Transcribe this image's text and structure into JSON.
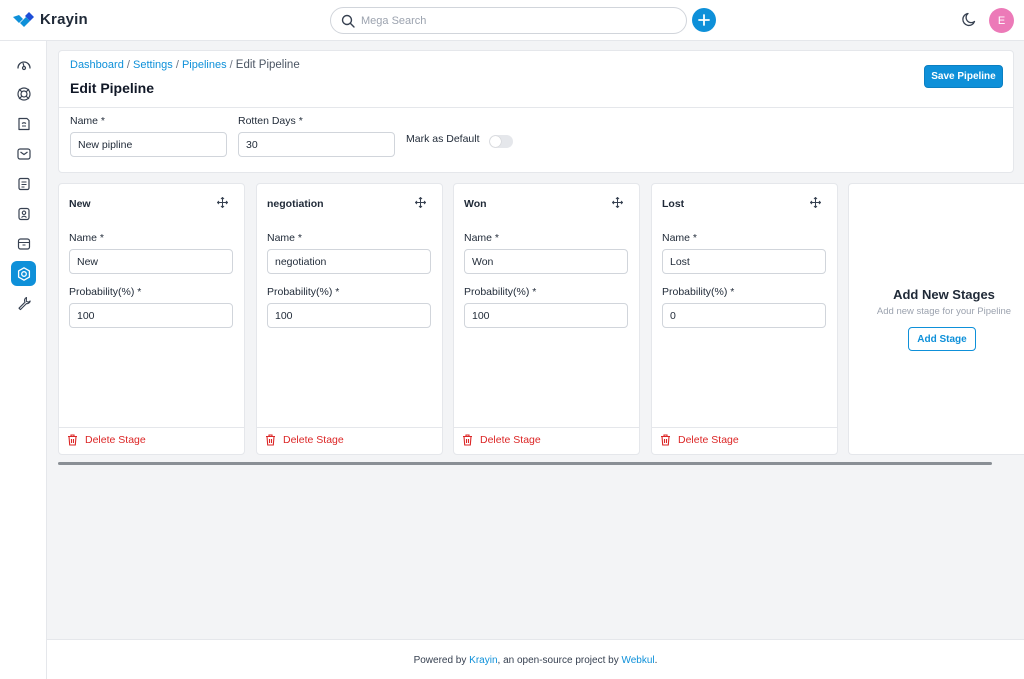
{
  "app": {
    "name": "Krayin"
  },
  "topbar": {
    "search_placeholder": "Mega Search",
    "avatar_initial": "E"
  },
  "breadcrumb": {
    "dashboard": "Dashboard",
    "settings": "Settings",
    "pipelines": "Pipelines",
    "current": "Edit Pipeline",
    "separator": "/"
  },
  "page": {
    "title": "Edit Pipeline",
    "save_label": "Save Pipeline"
  },
  "form": {
    "name_label": "Name *",
    "name_value": "New pipline",
    "rotten_label": "Rotten Days *",
    "rotten_value": "30",
    "default_label": "Mark as Default",
    "default_checked": false
  },
  "stages": [
    {
      "title": "New",
      "name_label": "Name *",
      "name_value": "New",
      "prob_label": "Probability(%) *",
      "prob_value": "100",
      "delete_label": "Delete Stage"
    },
    {
      "title": "negotiation",
      "name_label": "Name *",
      "name_value": "negotiation",
      "prob_label": "Probability(%) *",
      "prob_value": "100",
      "delete_label": "Delete Stage"
    },
    {
      "title": "Won",
      "name_label": "Name *",
      "name_value": "Won",
      "prob_label": "Probability(%) *",
      "prob_value": "100",
      "delete_label": "Delete Stage"
    },
    {
      "title": "Lost",
      "name_label": "Name *",
      "name_value": "Lost",
      "prob_label": "Probability(%) *",
      "prob_value": "0",
      "delete_label": "Delete Stage"
    }
  ],
  "add_stage": {
    "title": "Add New Stages",
    "subtitle": "Add new stage for your Pipeline",
    "button_label": "Add Stage"
  },
  "footer": {
    "prefix": "Powered by ",
    "krayin": "Krayin",
    "middle": ", an open-source project by ",
    "webkul": "Webkul",
    "suffix": "."
  },
  "colors": {
    "accent": "#0e90d9",
    "danger": "#dc2626",
    "avatar": "#ec7ab8"
  },
  "sidebar_icons": [
    "dashboard-icon",
    "leads-icon",
    "quotes-icon",
    "mail-icon",
    "activities-icon",
    "contacts-icon",
    "products-icon",
    "settings-icon",
    "configuration-icon"
  ]
}
